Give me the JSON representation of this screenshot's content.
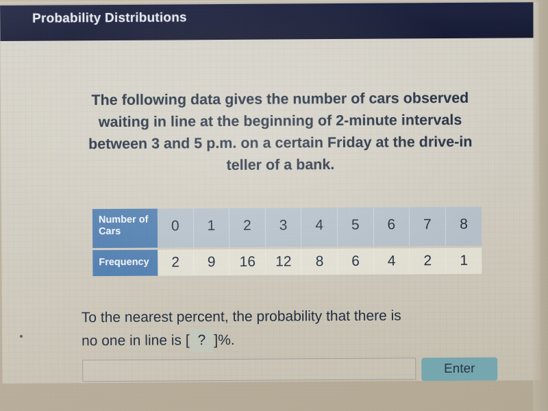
{
  "header": {
    "title": "Probability Distributions",
    "background_color": "#161b36",
    "text_color": "#e8eaf0"
  },
  "prompt": {
    "text": "The following data gives the number of cars observed waiting in line at the beginning of 2-minute intervals between 3 and 5 p.m. on a certain Friday at the drive-in teller of a bank."
  },
  "table": {
    "row_headers": [
      "Number of Cars",
      "Frequency"
    ],
    "cars": [
      "0",
      "1",
      "2",
      "3",
      "4",
      "5",
      "6",
      "7",
      "8"
    ],
    "frequency": [
      "2",
      "9",
      "16",
      "12",
      "8",
      "6",
      "4",
      "2",
      "1"
    ],
    "header_color": "#4c7cb0",
    "cars_row_color": "#b0becd",
    "frequency_row_color": "#ebeade"
  },
  "question": {
    "line1": "To the nearest percent, the probability that there is",
    "line2_before": "no one in line is [",
    "blank": "?",
    "line2_after": "]%."
  },
  "answer": {
    "input_value": "",
    "input_placeholder": "",
    "enter_label": "Enter",
    "enter_color": "#74a7b0"
  }
}
